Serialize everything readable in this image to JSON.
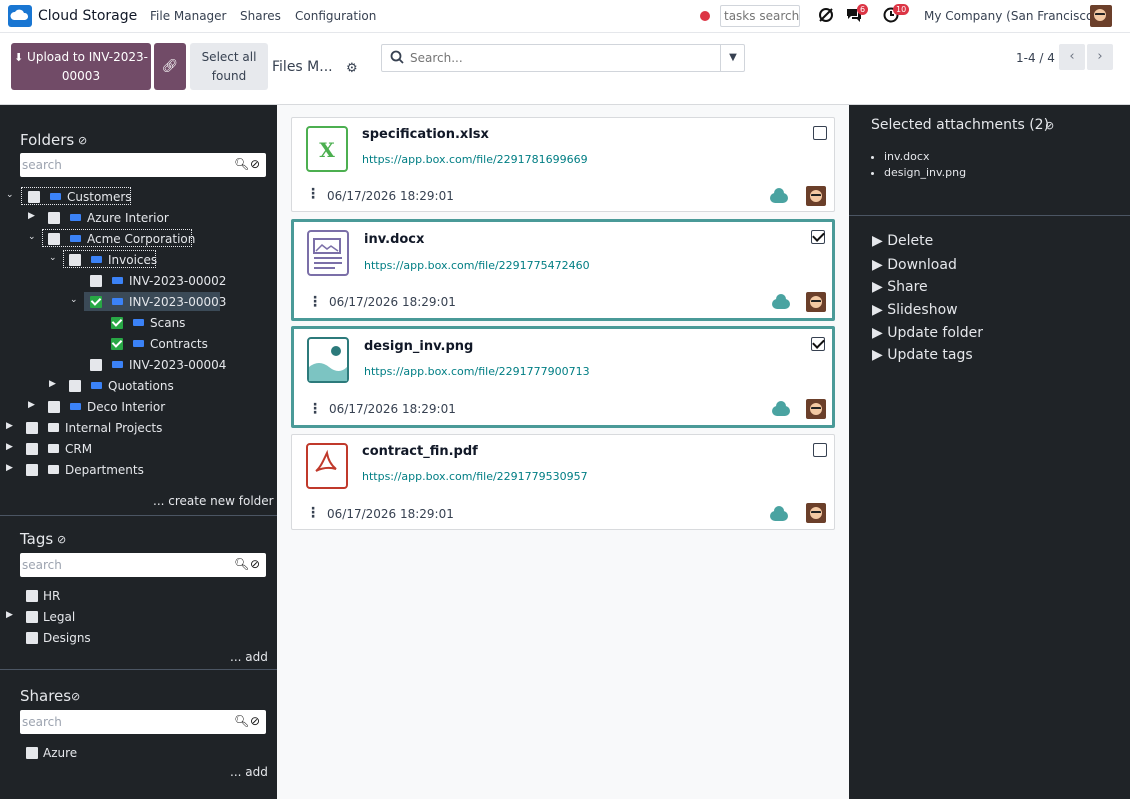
{
  "topbar": {
    "app_name": "Cloud Storage",
    "nav": [
      "File Manager",
      "Shares",
      "Configuration"
    ],
    "tasks_search_placeholder": "tasks search",
    "messages_badge": "6",
    "activities_badge": "10",
    "company": "My Company (San Francisco)"
  },
  "control_panel": {
    "upload_button": "Upload to INV-2023-00003",
    "select_all_button": "Select all found",
    "view_title": "Files M...",
    "search_placeholder": "Search...",
    "pager": "1-4 / 4"
  },
  "sidebar": {
    "folders_title": "Folders",
    "folders_search_placeholder": "search",
    "tree": [
      {
        "label": "Customers"
      },
      {
        "label": "Azure Interior"
      },
      {
        "label": "Acme Corporation"
      },
      {
        "label": "Invoices"
      },
      {
        "label": "INV-2023-00002"
      },
      {
        "label": "INV-2023-00003"
      },
      {
        "label": "Scans"
      },
      {
        "label": "Contracts"
      },
      {
        "label": "INV-2023-00004"
      },
      {
        "label": "Quotations"
      },
      {
        "label": "Deco Interior"
      },
      {
        "label": "Internal Projects"
      },
      {
        "label": "CRM"
      },
      {
        "label": "Departments"
      }
    ],
    "create_folder": "... create new folder",
    "tags_title": "Tags",
    "tags_search_placeholder": "search",
    "tags": [
      "HR",
      "Legal",
      "Designs"
    ],
    "tags_add": "... add",
    "shares_title": "Shares",
    "shares_search_placeholder": "search",
    "shares": [
      "Azure"
    ],
    "shares_add": "... add"
  },
  "files": [
    {
      "name": "specification.xlsx",
      "url": "https://app.box.com/file/2291781699669",
      "date": "06/17/2026 18:29:01",
      "selected": false,
      "icon": "excel-icon"
    },
    {
      "name": "inv.docx",
      "url": "https://app.box.com/file/2291775472460",
      "date": "06/17/2026 18:29:01",
      "selected": true,
      "icon": "document-icon"
    },
    {
      "name": "design_inv.png",
      "url": "https://app.box.com/file/2291777900713",
      "date": "06/17/2026 18:29:01",
      "selected": true,
      "icon": "image-icon"
    },
    {
      "name": "contract_fin.pdf",
      "url": "https://app.box.com/file/2291779530957",
      "date": "06/17/2026 18:29:01",
      "selected": false,
      "icon": "pdf-icon"
    }
  ],
  "right_panel": {
    "title": "Selected attachments (2)",
    "selected": [
      "inv.docx",
      "design_inv.png"
    ],
    "actions": [
      "Delete",
      "Download",
      "Share",
      "Slideshow",
      "Update folder",
      "Update tags"
    ]
  },
  "colors": {
    "primary": "#714b67",
    "sidebar_bg": "#1f2327",
    "teal": "#4a9a98",
    "link": "#017e84"
  }
}
